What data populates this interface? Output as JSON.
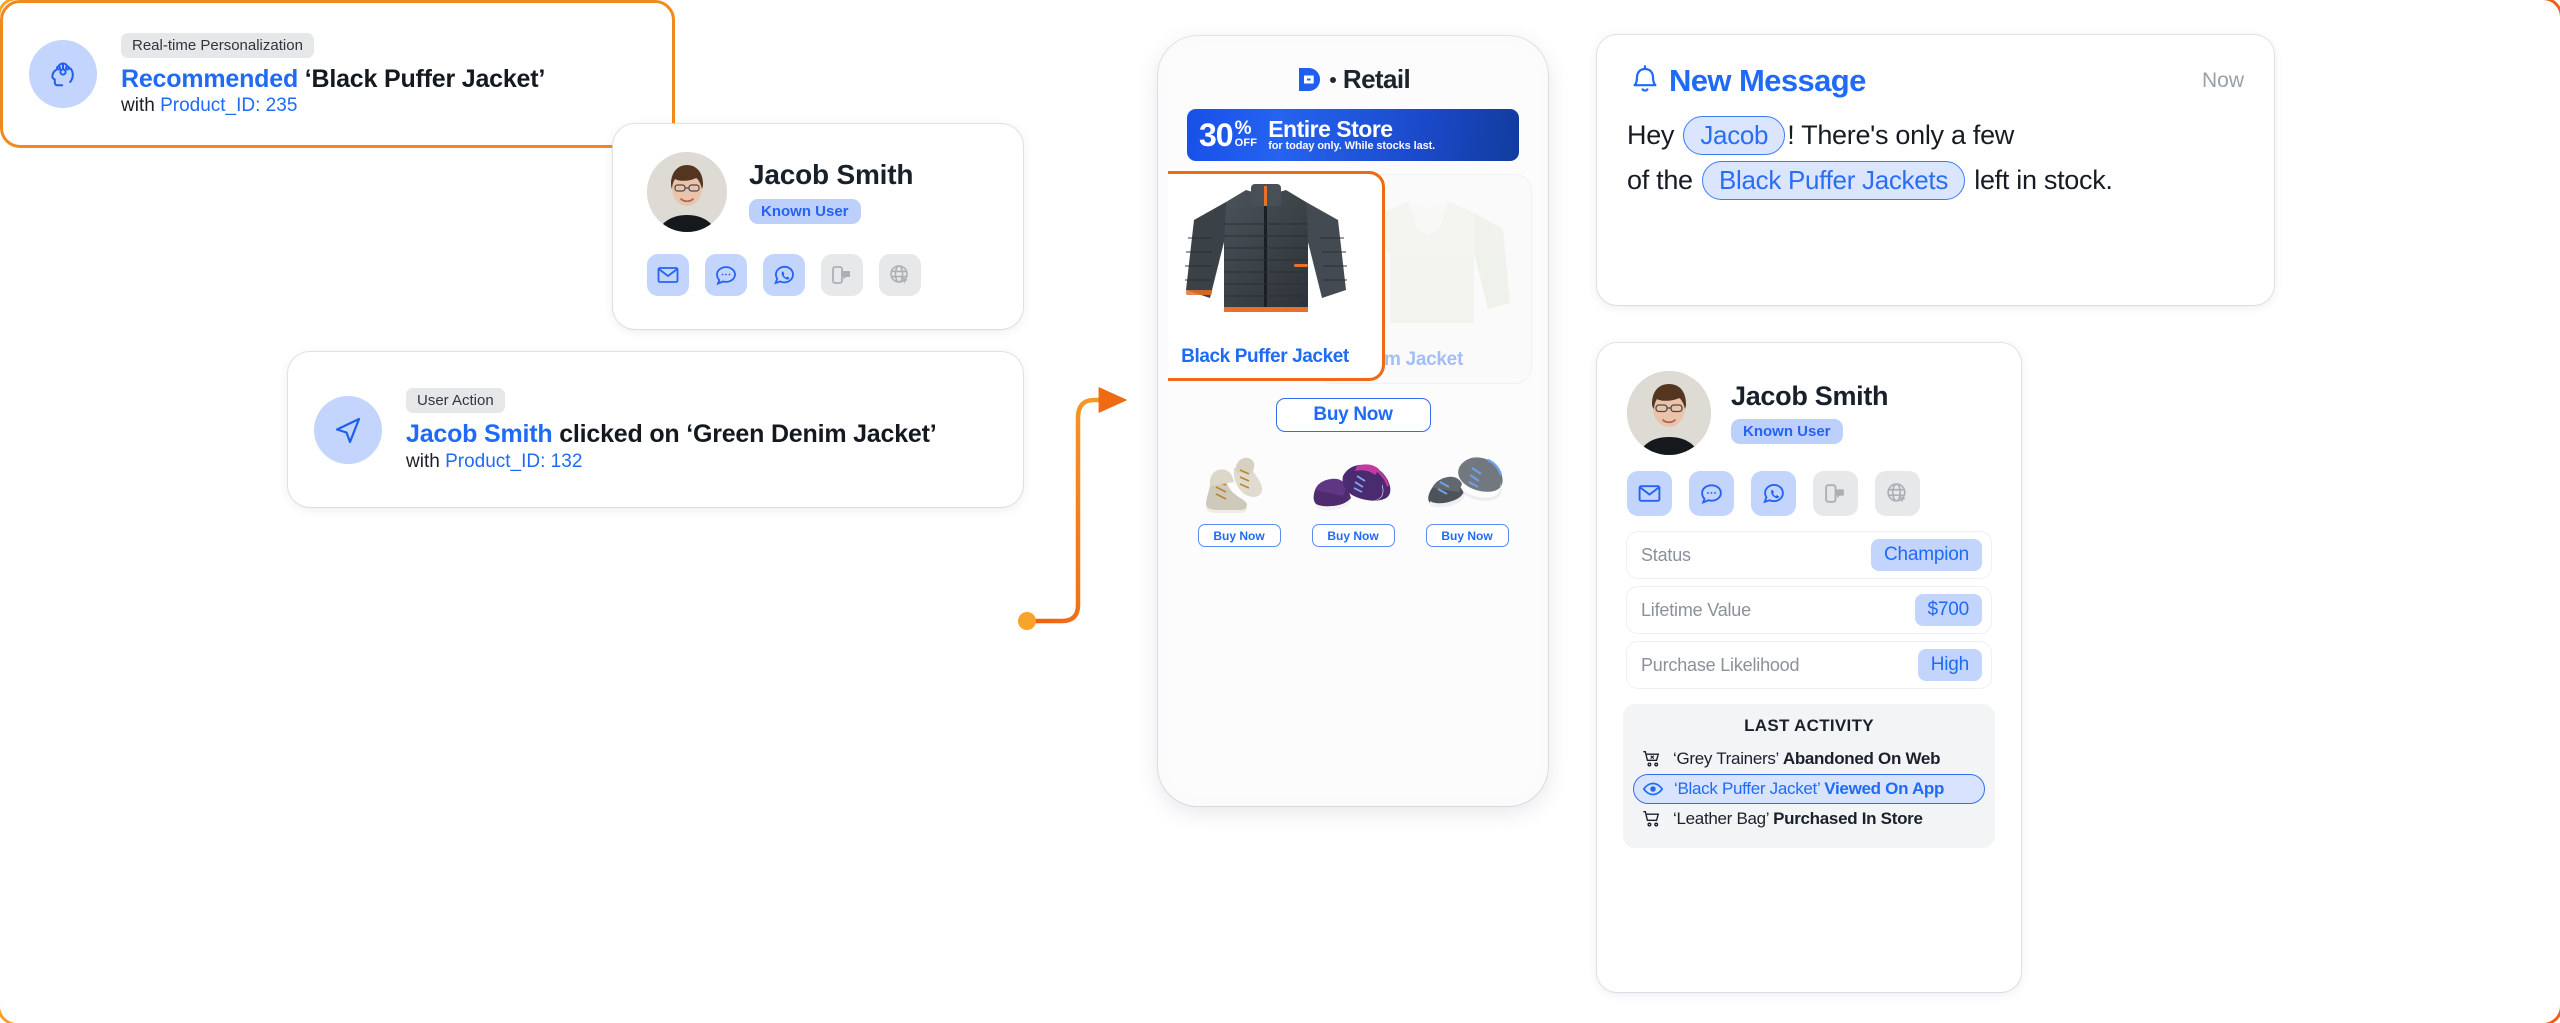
{
  "profile_left": {
    "name": "Jacob Smith",
    "badge": "Known User",
    "channels": [
      {
        "name": "email-icon",
        "active": true
      },
      {
        "name": "sms-chat-icon",
        "active": true
      },
      {
        "name": "whatsapp-icon",
        "active": true
      },
      {
        "name": "push-notification-icon",
        "active": false
      },
      {
        "name": "web-globe-icon",
        "active": false
      }
    ]
  },
  "user_action": {
    "tag": "User Action",
    "actor": "Jacob Smith",
    "verb": " clicked on ‘Green Denim Jacket’",
    "meta_prefix": "with ",
    "meta_value": "Product_ID: 132",
    "icon": "navigation-arrow-icon"
  },
  "personalization": {
    "tag": "Real-time Personalization",
    "actor": "Recommended",
    "verb": " ‘Black Puffer Jacket’",
    "meta_prefix": "with ",
    "meta_value": "Product_ID: 235",
    "icon": "ai-brain-head-icon"
  },
  "phone": {
    "brand": "Retail",
    "promo": {
      "percent": "30",
      "percent_symbol": "%",
      "off": "OFF",
      "headline": "Entire Store",
      "subline": "for today only. While stocks last."
    },
    "product_recommended": "Black Puffer Jacket",
    "product_ghost": "Green Denim Jacket",
    "product_ghost_visible": "m Jacket",
    "buy_main": "Buy Now",
    "buy_small": [
      "Buy Now",
      "Buy Now",
      "Buy Now"
    ]
  },
  "message": {
    "title": "New Message",
    "time": "Now",
    "icon": "bell-icon",
    "text_before": "Hey ",
    "pill_name": "Jacob",
    "text_mid": "! There's only a few",
    "text_line2_before": "of the ",
    "pill_product": "Black Puffer Jackets",
    "text_after": " left in stock."
  },
  "profile_right": {
    "name": "Jacob Smith",
    "badge": "Known User",
    "channels": [
      {
        "name": "email-icon",
        "active": true
      },
      {
        "name": "sms-chat-icon",
        "active": true
      },
      {
        "name": "whatsapp-icon",
        "active": true
      },
      {
        "name": "push-notification-icon",
        "active": false
      },
      {
        "name": "web-globe-icon",
        "active": false
      }
    ],
    "stats": [
      {
        "label": "Status",
        "value": "Champion"
      },
      {
        "label": "Lifetime Value",
        "value": "$700"
      },
      {
        "label": "Purchase Likelihood",
        "value": "High"
      }
    ],
    "activity_title": "LAST ACTIVITY",
    "activities": [
      {
        "icon": "cart-remove-icon",
        "item": "‘Grey Trainers’",
        "action": "Abandoned On Web",
        "highlight": false
      },
      {
        "icon": "eye-icon",
        "item": "‘Black Puffer Jacket’",
        "action": "Viewed On App",
        "highlight": true
      },
      {
        "icon": "cart-icon",
        "item": "‘Leather Bag’",
        "action": "Purchased In Store",
        "highlight": false
      }
    ]
  },
  "colors": {
    "brand_blue": "#1f6bf5",
    "accent_orange": "#ef6a14",
    "pill_blue_bg": "#c3d4fd",
    "page_bg": "#ffffff"
  }
}
